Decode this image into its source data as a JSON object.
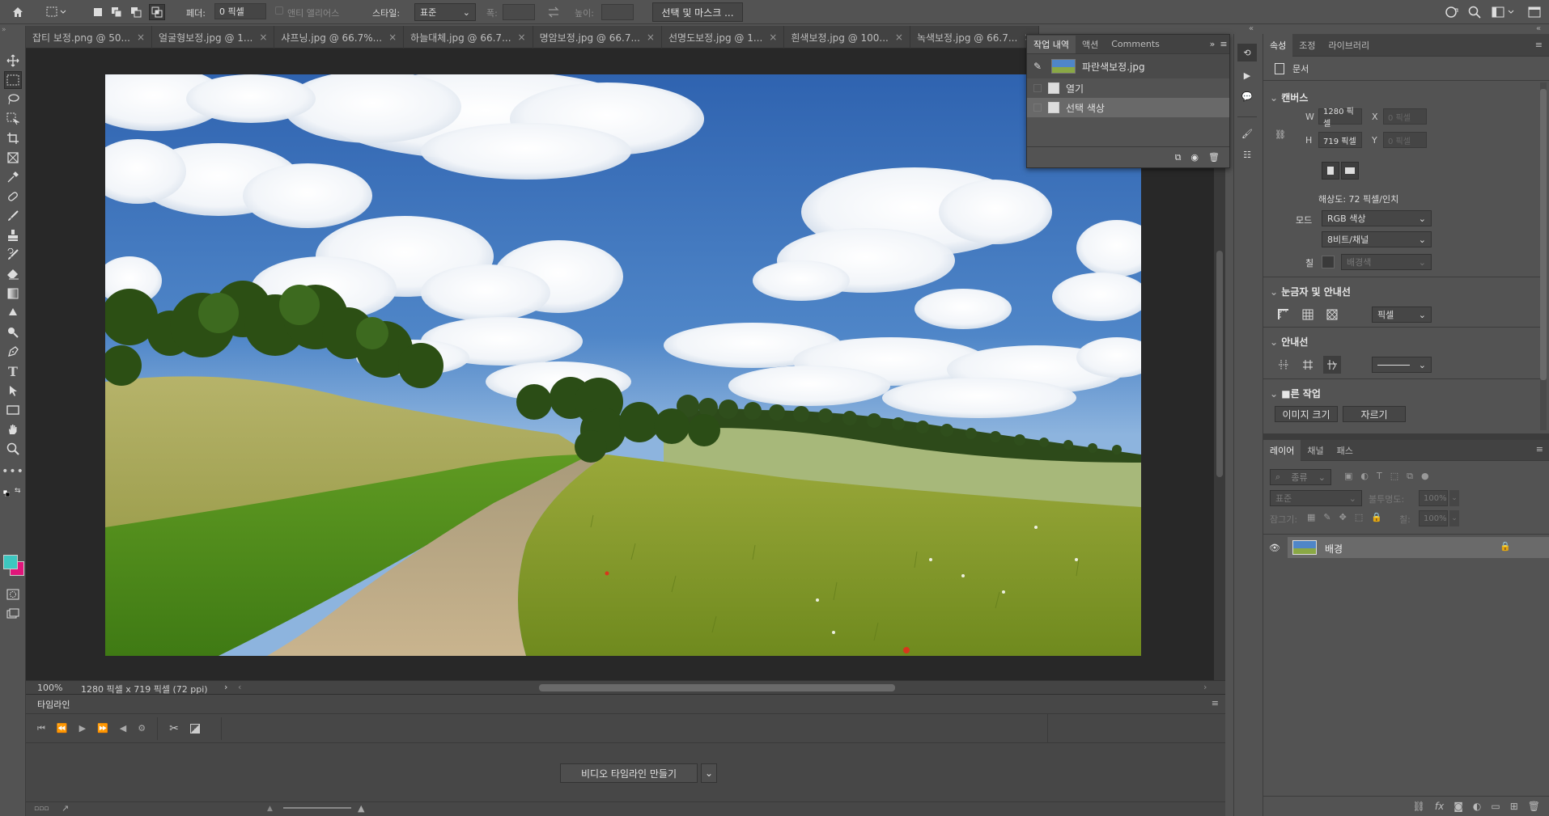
{
  "options_bar": {
    "feather_label": "페더:",
    "feather_value": "0 픽셀",
    "antialias_label": "앤티 앨리어스",
    "style_label": "스타일:",
    "style_value": "표준",
    "width_label": "폭:",
    "height_label": "높이:",
    "select_mask_label": "선택 및 마스크 ..."
  },
  "doc_tabs": [
    {
      "label": "잡티 보정.png @ 50..."
    },
    {
      "label": "얼굴형보정.jpg @ 1..."
    },
    {
      "label": "샤프닝.jpg @ 66.7%..."
    },
    {
      "label": "하늘대체.jpg @ 66.7..."
    },
    {
      "label": "명암보정.jpg @ 66.7..."
    },
    {
      "label": "선명도보정.jpg @ 1..."
    },
    {
      "label": "흰색보정.jpg @ 100..."
    },
    {
      "label": "녹색보정.jpg @ 66.7..."
    }
  ],
  "history_panel": {
    "tabs": [
      "작업 내역",
      "액션",
      "Comments"
    ],
    "snapshot": "파란색보정.jpg",
    "items": [
      "열기",
      "선택 색상"
    ]
  },
  "status": {
    "zoom": "100%",
    "doc_info": "1280 픽셀 x 719 픽셀 (72 ppi)"
  },
  "timeline": {
    "title": "타임라인",
    "create_button": "비디오 타임라인 만들기"
  },
  "properties": {
    "tabs": [
      "속성",
      "조정",
      "라이브러리"
    ],
    "doc_label": "문서",
    "canvas_title": "캔버스",
    "w_label": "W",
    "w_value": "1280 픽셀",
    "h_label": "H",
    "h_value": "719 픽셀",
    "x_label": "X",
    "x_value": "0 픽셀",
    "y_label": "Y",
    "y_value": "0 픽셀",
    "resolution": "해상도: 72 픽셀/인치",
    "mode_label": "모드",
    "mode_value": "RGB 색상",
    "depth_value": "8비트/채널",
    "fill_label": "칠",
    "fill_value": "배경색",
    "rulers_title": "눈금자 및 안내선",
    "rulers_unit": "픽셀",
    "guides_title": "안내선",
    "quick_title": "■른 작업",
    "image_size_btn": "이미지 크기",
    "crop_btn": "자르기"
  },
  "layers": {
    "tabs": [
      "레이어",
      "채널",
      "패스"
    ],
    "filter_kind": "종류",
    "blend_mode": "표준",
    "opacity_label": "불투명도:",
    "opacity_value": "100%",
    "lock_label": "잠그기:",
    "fill_label": "칠:",
    "fill_value": "100%",
    "layer_name": "배경"
  },
  "colors": {
    "foreground": "#3dc7c0",
    "background": "#e0157a",
    "accent": "#2e6da4"
  }
}
